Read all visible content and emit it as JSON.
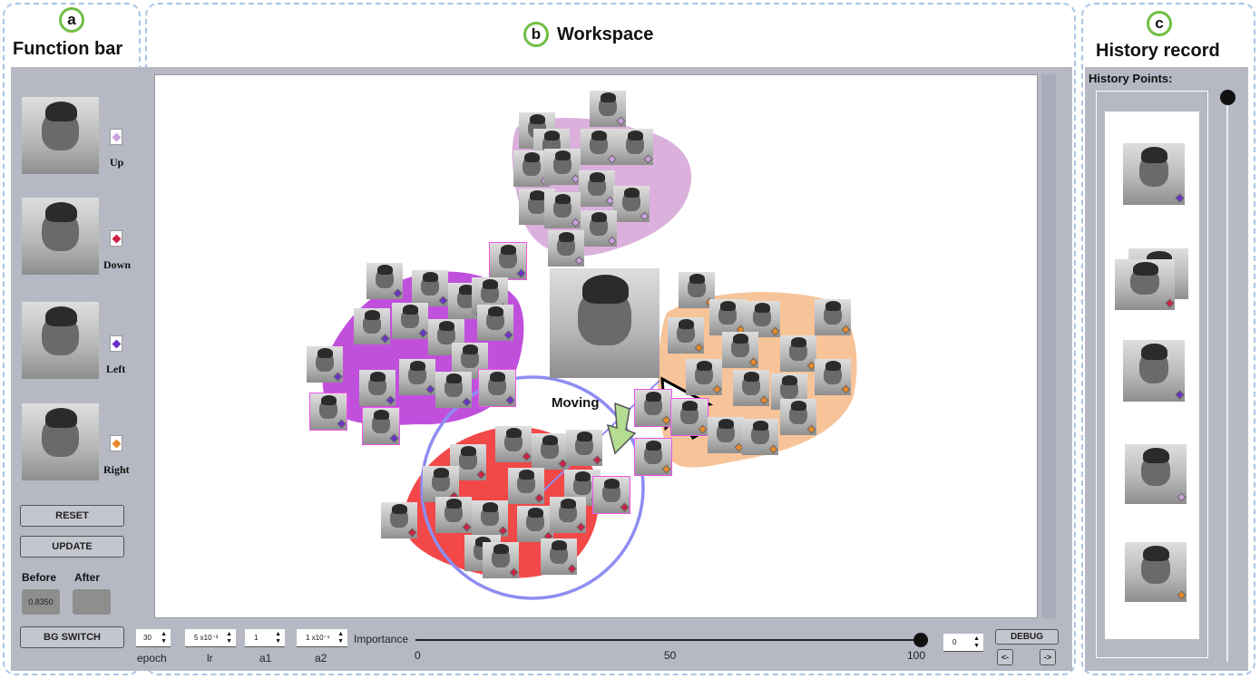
{
  "panels": {
    "a": {
      "letter": "a",
      "title": "Function bar"
    },
    "b": {
      "letter": "b",
      "title": "Workspace"
    },
    "c": {
      "letter": "c",
      "title": "History record"
    }
  },
  "function_bar": {
    "legend": [
      {
        "label": "Up",
        "color": "#c9a0dc"
      },
      {
        "label": "Down",
        "color": "#cc2244"
      },
      {
        "label": "Left",
        "color": "#6a32c8"
      },
      {
        "label": "Right",
        "color": "#e88a2a"
      }
    ],
    "reset_label": "RESET",
    "update_label": "UPDATE",
    "before_label": "Before",
    "after_label": "After",
    "before_value": "0.8350",
    "after_value": "",
    "bg_switch_label": "BG SWITCH"
  },
  "workspace": {
    "moving_label": "Moving",
    "cluster_colors": {
      "up": "#dcb0dc",
      "left": "#c050dc",
      "right": "#f7c49a",
      "down": "#f24848"
    },
    "controls": {
      "epoch_value": "30",
      "epoch_label": "epoch",
      "lr_value": "5 x10⁻³",
      "lr_label": "lr",
      "a1_value": "1",
      "a1_label": "a1",
      "a2_value": "1 x10⁻¹",
      "a2_label": "a2",
      "importance_label": "Importance",
      "importance_ticks": [
        "0",
        "50",
        "100"
      ],
      "importance_value": 100,
      "index_value": "0",
      "debug_label": "DEBUG",
      "prev_label": "<-",
      "next_label": "->"
    }
  },
  "history": {
    "label": "History Points:",
    "slider_position": 0
  }
}
